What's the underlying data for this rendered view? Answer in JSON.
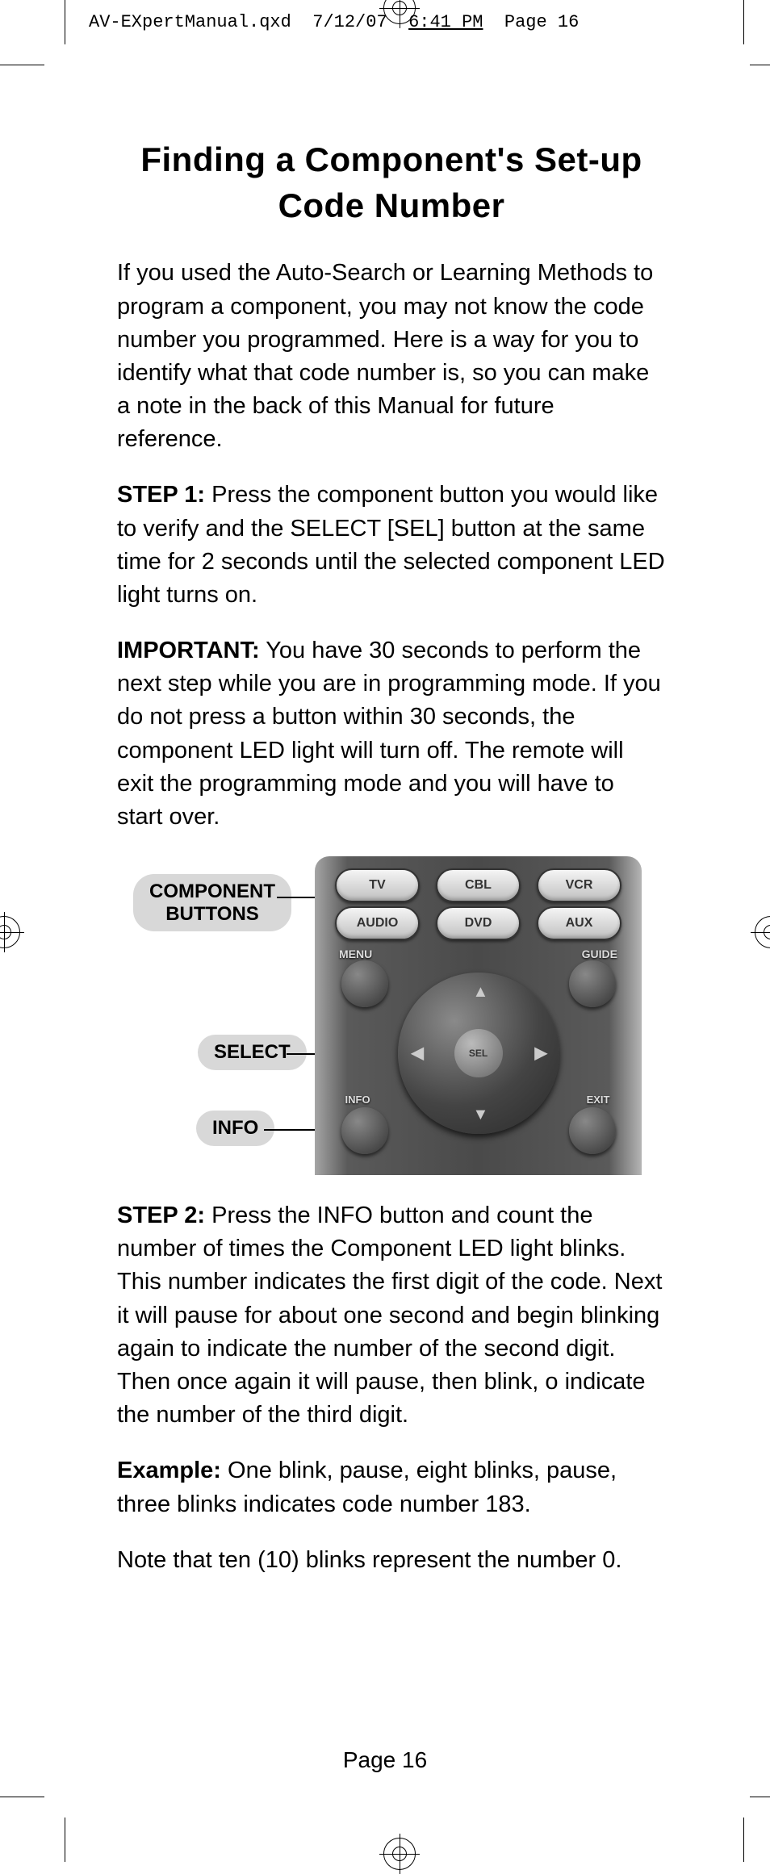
{
  "meta": {
    "filename": "AV-EXpertManual.qxd",
    "date": "7/12/07",
    "time": "6:41 PM",
    "page_ref": "Page 16"
  },
  "title": "Finding a Component's Set-up Code Number",
  "intro": "If you used the Auto-Search or Learning Methods to program a component, you may not know the code number you programmed. Here is a way for you to identify what that code number is, so you can make a note in the back of this Manual for future reference.",
  "step1_label": "STEP 1:",
  "step1_text": " Press the component button you would like to verify and the SELECT [SEL] button at the same time for 2 seconds until the selected component LED light turns on.",
  "important_label": "IMPORTANT:",
  "important_text": " You have 30 seconds to perform the next step while you are in programming mode. If you do not press a button within 30 seconds, the component LED light will turn off. The remote will exit the programming mode and you will have to start over.",
  "callouts": {
    "component": "COMPONENT BUTTONS",
    "select": "SELECT",
    "info": "INFO"
  },
  "remote": {
    "row1": [
      "TV",
      "CBL",
      "VCR"
    ],
    "row2": [
      "AUDIO",
      "DVD",
      "AUX"
    ],
    "menu": "MENU",
    "guide": "GUIDE",
    "info": "INFO",
    "exit": "EXIT",
    "sel": "SEL"
  },
  "step2_label": "STEP 2:",
  "step2_text": " Press the INFO button and count the number of times the Component LED light blinks. This number indicates the first digit of the code. Next it will pause for about one second and begin blinking again to indicate the number of the second digit. Then once again it will pause, then blink, o indicate the number of the third digit.",
  "example_label": "Example:",
  "example_text": " One blink, pause, eight blinks, pause, three blinks indicates code number 183.",
  "note_text": "Note that ten (10) blinks represent the number 0.",
  "page_footer": "Page 16"
}
